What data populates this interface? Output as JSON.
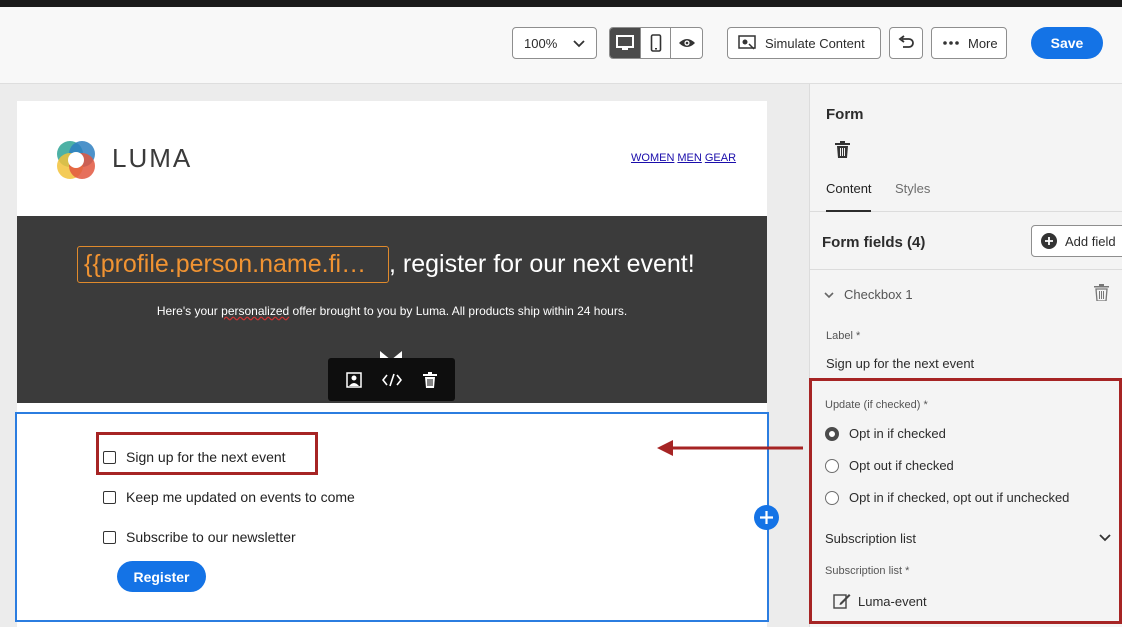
{
  "toolbar": {
    "zoom": "100%",
    "simulate_label": "Simulate Content",
    "more_label": "More",
    "save_label": "Save"
  },
  "email": {
    "brand": "LUMA",
    "nav_links": [
      "WOMEN",
      "MEN",
      "GEAR"
    ],
    "token": "{{profile.person.name.fi…",
    "headline": ", register for our next event!",
    "subline_pre": "Here's your ",
    "subline_spell": "personalized",
    "subline_post": " offer brought to you by Luma. All products ship within 24 hours.",
    "checkboxes": [
      "Sign up for the next event",
      "Keep me updated on events to come",
      "Subscribe to our newsletter"
    ],
    "register_label": "Register"
  },
  "panel": {
    "title": "Form",
    "tabs": [
      "Content",
      "Styles"
    ],
    "form_fields_title": "Form fields (4)",
    "add_field_label": "Add field",
    "checkbox_section": "Checkbox 1",
    "label_label": "Label",
    "label_value": "Sign up for the next event",
    "update_label": "Update (if checked)",
    "radio_options": [
      "Opt in if checked",
      "Opt out if checked",
      "Opt in if checked, opt out if unchecked"
    ],
    "subscription_section": "Subscription list",
    "subscription_label": "Subscription list",
    "subscription_value": "Luma-event",
    "required_mark": "*"
  },
  "colors": {
    "accent": "#1473e6",
    "highlight_red": "#a62424",
    "token_orange": "#f09332",
    "banner_bg": "#3b3b3b"
  }
}
